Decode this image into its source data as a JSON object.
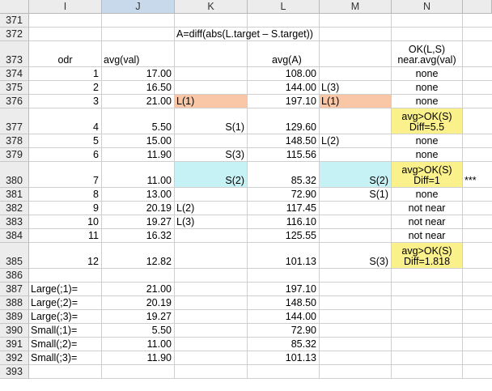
{
  "colors": {
    "orange": "#f9c7a6",
    "cyan": "#c7f2f5",
    "yellow": "#faf08c",
    "header_bg": "#ececec",
    "selected_header": "#c9d9ec",
    "grid": "#cfcfcf"
  },
  "columns": [
    {
      "letter": "I",
      "selected": false
    },
    {
      "letter": "J",
      "selected": true
    },
    {
      "letter": "K",
      "selected": false
    },
    {
      "letter": "L",
      "selected": false
    },
    {
      "letter": "M",
      "selected": false
    },
    {
      "letter": "N",
      "selected": false
    },
    {
      "letter": "",
      "selected": false
    }
  ],
  "rows": [
    {
      "num": "371",
      "h": 17,
      "cells": {}
    },
    {
      "num": "372",
      "h": 17,
      "cells": {
        "K": {
          "v": "A=diff(abs(L.target – S.target))",
          "a": "l"
        }
      }
    },
    {
      "num": "373",
      "h": 32,
      "cells": {
        "I": {
          "v": "odr",
          "a": "c"
        },
        "J": {
          "v": "avg(val)",
          "a": "l"
        },
        "L": {
          "v": "avg(A)",
          "a": "l",
          "indent": 30
        },
        "N": {
          "lines": [
            "OK(L,S)",
            "near.avg(val)"
          ],
          "a": "c"
        }
      }
    },
    {
      "num": "374",
      "h": 17,
      "cells": {
        "I": {
          "v": "1",
          "a": "r"
        },
        "J": {
          "v": "17.00",
          "a": "r"
        },
        "L": {
          "v": "108.00",
          "a": "r"
        },
        "N": {
          "v": "none",
          "a": "c"
        }
      }
    },
    {
      "num": "375",
      "h": 17,
      "cells": {
        "I": {
          "v": "2",
          "a": "r"
        },
        "J": {
          "v": "16.50",
          "a": "r"
        },
        "L": {
          "v": "144.00",
          "a": "r"
        },
        "M": {
          "v": "L(3)",
          "a": "l"
        },
        "N": {
          "v": "none",
          "a": "c"
        }
      }
    },
    {
      "num": "376",
      "h": 17,
      "cells": {
        "I": {
          "v": "3",
          "a": "r"
        },
        "J": {
          "v": "21.00",
          "a": "r"
        },
        "K": {
          "v": "L(1)",
          "a": "l",
          "fill": "orange"
        },
        "L": {
          "v": "197.10",
          "a": "r"
        },
        "M": {
          "v": "L(1)",
          "a": "l",
          "fill": "orange"
        },
        "N": {
          "v": "none",
          "a": "c"
        }
      }
    },
    {
      "num": "377",
      "h": 32,
      "cells": {
        "I": {
          "v": "4",
          "a": "r"
        },
        "J": {
          "v": "5.50",
          "a": "r"
        },
        "K": {
          "v": "S(1)",
          "a": "r"
        },
        "L": {
          "v": "129.60",
          "a": "r"
        },
        "N": {
          "lines": [
            "avg>OK(S)",
            "Diff=5.5"
          ],
          "a": "c",
          "fill": "yellow"
        }
      }
    },
    {
      "num": "378",
      "h": 17,
      "cells": {
        "I": {
          "v": "5",
          "a": "r"
        },
        "J": {
          "v": "15.00",
          "a": "r"
        },
        "L": {
          "v": "148.50",
          "a": "r"
        },
        "M": {
          "v": "L(2)",
          "a": "l"
        },
        "N": {
          "v": "none",
          "a": "c"
        }
      }
    },
    {
      "num": "379",
      "h": 17,
      "cells": {
        "I": {
          "v": "6",
          "a": "r"
        },
        "J": {
          "v": "11.90",
          "a": "r"
        },
        "K": {
          "v": "S(3)",
          "a": "r"
        },
        "L": {
          "v": "115.56",
          "a": "r"
        },
        "N": {
          "v": "none",
          "a": "c"
        }
      }
    },
    {
      "num": "380",
      "h": 32,
      "cells": {
        "I": {
          "v": "7",
          "a": "r"
        },
        "J": {
          "v": "11.00",
          "a": "r"
        },
        "K": {
          "v": "S(2)",
          "a": "r",
          "fill": "cyan"
        },
        "L": {
          "v": "85.32",
          "a": "r"
        },
        "M": {
          "v": "S(2)",
          "a": "r",
          "fill": "cyan"
        },
        "N": {
          "lines": [
            "avg>OK(S)",
            "Diff=1"
          ],
          "a": "c",
          "fill": "yellow"
        },
        "X": {
          "v": "***",
          "a": "l"
        }
      }
    },
    {
      "num": "381",
      "h": 17,
      "cells": {
        "I": {
          "v": "8",
          "a": "r"
        },
        "J": {
          "v": "13.00",
          "a": "r"
        },
        "L": {
          "v": "72.90",
          "a": "r"
        },
        "M": {
          "v": "S(1)",
          "a": "r"
        },
        "N": {
          "v": "none",
          "a": "c"
        }
      }
    },
    {
      "num": "382",
      "h": 17,
      "cells": {
        "I": {
          "v": "9",
          "a": "r"
        },
        "J": {
          "v": "20.19",
          "a": "r"
        },
        "K": {
          "v": "L(2)",
          "a": "l"
        },
        "L": {
          "v": "117.45",
          "a": "r"
        },
        "N": {
          "v": "not near",
          "a": "c"
        }
      }
    },
    {
      "num": "383",
      "h": 17,
      "cells": {
        "I": {
          "v": "10",
          "a": "r"
        },
        "J": {
          "v": "19.27",
          "a": "r"
        },
        "K": {
          "v": "L(3)",
          "a": "l"
        },
        "L": {
          "v": "116.10",
          "a": "r"
        },
        "N": {
          "v": "not near",
          "a": "c"
        }
      }
    },
    {
      "num": "384",
      "h": 17,
      "cells": {
        "I": {
          "v": "11",
          "a": "r"
        },
        "J": {
          "v": "16.32",
          "a": "r"
        },
        "L": {
          "v": "125.55",
          "a": "r"
        },
        "N": {
          "v": "not near",
          "a": "c"
        }
      }
    },
    {
      "num": "385",
      "h": 32,
      "cells": {
        "I": {
          "v": "12",
          "a": "r"
        },
        "J": {
          "v": "12.82",
          "a": "r"
        },
        "L": {
          "v": "101.13",
          "a": "r"
        },
        "M": {
          "v": "S(3)",
          "a": "r"
        },
        "N": {
          "lines": [
            "avg>OK(S)",
            "Diff=1.818"
          ],
          "a": "c",
          "fill": "yellow"
        }
      }
    },
    {
      "num": "386",
      "h": 17,
      "cells": {}
    },
    {
      "num": "387",
      "h": 17,
      "cells": {
        "I": {
          "v": "Large(;1)=",
          "a": "l"
        },
        "J": {
          "v": "21.00",
          "a": "r"
        },
        "L": {
          "v": "197.10",
          "a": "r"
        }
      }
    },
    {
      "num": "388",
      "h": 17,
      "cells": {
        "I": {
          "v": "Large(;2)=",
          "a": "l"
        },
        "J": {
          "v": "20.19",
          "a": "r"
        },
        "L": {
          "v": "148.50",
          "a": "r"
        }
      }
    },
    {
      "num": "389",
      "h": 17,
      "cells": {
        "I": {
          "v": "Large(;3)=",
          "a": "l"
        },
        "J": {
          "v": "19.27",
          "a": "r"
        },
        "L": {
          "v": "144.00",
          "a": "r"
        }
      }
    },
    {
      "num": "390",
      "h": 17,
      "cells": {
        "I": {
          "v": "Small(;1)=",
          "a": "l"
        },
        "J": {
          "v": "5.50",
          "a": "r"
        },
        "L": {
          "v": "72.90",
          "a": "r"
        }
      }
    },
    {
      "num": "391",
      "h": 17,
      "cells": {
        "I": {
          "v": "Small(;2)=",
          "a": "l"
        },
        "J": {
          "v": "11.00",
          "a": "r"
        },
        "L": {
          "v": "85.32",
          "a": "r"
        }
      }
    },
    {
      "num": "392",
      "h": 17,
      "cells": {
        "I": {
          "v": "Small(;3)=",
          "a": "l"
        },
        "J": {
          "v": "11.90",
          "a": "r"
        },
        "L": {
          "v": "101.13",
          "a": "r"
        }
      }
    },
    {
      "num": "393",
      "h": 17,
      "cells": {}
    }
  ]
}
